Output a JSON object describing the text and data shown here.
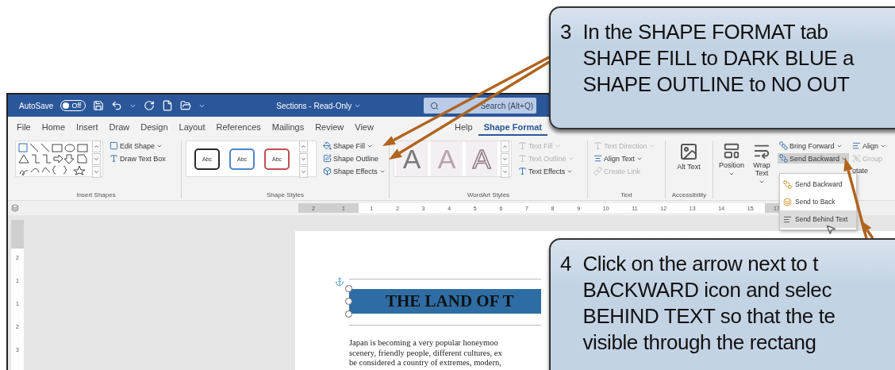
{
  "title_bar": {
    "autosave_label": "AutoSave",
    "autosave_state": "Off",
    "autosave_on": false,
    "document_title": "Sections - Read-Only",
    "search_placeholder": "Search (Alt+Q)"
  },
  "tabs": [
    {
      "label": "File",
      "selected": false
    },
    {
      "label": "Home",
      "selected": false
    },
    {
      "label": "Insert",
      "selected": false
    },
    {
      "label": "Draw",
      "selected": false
    },
    {
      "label": "Design",
      "selected": false
    },
    {
      "label": "Layout",
      "selected": false
    },
    {
      "label": "References",
      "selected": false
    },
    {
      "label": "Mailings",
      "selected": false
    },
    {
      "label": "Review",
      "selected": false
    },
    {
      "label": "View",
      "selected": false
    },
    {
      "label": "Help",
      "selected": false
    },
    {
      "label": "Shape Format",
      "selected": true
    }
  ],
  "ribbon": [
    {
      "kind": "insert_shapes",
      "label": "Insert Shapes",
      "commands": [
        {
          "label": "Edit Shape",
          "dropdown": true,
          "disabled": false
        },
        {
          "label": "Draw Text Box",
          "dropdown": false,
          "disabled": false
        }
      ]
    },
    {
      "kind": "shape_styles",
      "label": "Shape Styles",
      "presets": [
        {
          "label": "Abc",
          "color": "#2b2b2b"
        },
        {
          "label": "Abc",
          "color": "#4f86c6"
        },
        {
          "label": "Abc",
          "color": "#c0504d"
        }
      ],
      "commands": [
        {
          "label": "Shape Fill",
          "dropdown": true,
          "disabled": false
        },
        {
          "label": "Shape Outline",
          "dropdown": false,
          "disabled": false
        },
        {
          "label": "Shape Effects",
          "dropdown": true,
          "disabled": false
        }
      ]
    },
    {
      "kind": "wordart",
      "label": "WordArt Styles",
      "letters": [
        "A",
        "A",
        "A"
      ],
      "commands": [
        {
          "label": "Text Fill",
          "dropdown": true,
          "disabled": true
        },
        {
          "label": "Text Outline",
          "dropdown": true,
          "disabled": true
        },
        {
          "label": "Text Effects",
          "dropdown": true,
          "disabled": false
        }
      ]
    },
    {
      "kind": "text",
      "label": "Text",
      "commands": [
        {
          "label": "Text Direction",
          "dropdown": true,
          "disabled": true
        },
        {
          "label": "Align Text",
          "dropdown": true,
          "disabled": false
        },
        {
          "label": "Create Link",
          "dropdown": false,
          "disabled": true
        }
      ]
    },
    {
      "kind": "accessibility",
      "label": "Accessibility",
      "commands": [
        {
          "label": "Alt Text"
        }
      ]
    },
    {
      "kind": "arrange",
      "large": [
        {
          "label": "Position",
          "dropdown": true
        },
        {
          "label": "Wrap Text",
          "dropdown": true
        }
      ],
      "commands": [
        {
          "label": "Bring Forward",
          "dropdown": true,
          "disabled": false,
          "active": false
        },
        {
          "label": "Send Backward",
          "dropdown": true,
          "disabled": false,
          "active": true
        }
      ],
      "commands_2": [
        {
          "label": "Align",
          "dropdown": true,
          "disabled": false
        },
        {
          "label": "Group",
          "dropdown": false,
          "disabled": true
        },
        {
          "label": "otate",
          "dropdown": false,
          "disabled": false
        }
      ]
    }
  ],
  "ruler": {
    "left_ticks": [
      "2",
      "1"
    ],
    "ticks": [
      "1",
      "2",
      "3",
      "4",
      "5",
      "6",
      "7",
      "8",
      "9",
      "10",
      "11",
      "12",
      "13",
      "14",
      "15"
    ],
    "right_ticks": [
      "17"
    ]
  },
  "vertical_ruler": [
    "2",
    "1",
    "1",
    "2",
    "3"
  ],
  "send_backward_menu": [
    {
      "label": "Send Backward",
      "selected": false
    },
    {
      "label": "Send to Back",
      "selected": false
    },
    {
      "label": "Send Behind Text",
      "selected": true
    }
  ],
  "document": {
    "heading": "THE LAND OF T",
    "paragraph_lines": [
      "Japan is becoming a very popular honeymoo",
      "scenery, friendly people, different cultures, ex",
      "be considered a country of extremes, modern,"
    ]
  },
  "callouts": [
    {
      "number": "3",
      "lines": [
        "In the SHAPE FORMAT tab",
        "SHAPE FILL to DARK BLUE a",
        "SHAPE OUTLINE to NO OUT"
      ]
    },
    {
      "number": "4",
      "lines": [
        "Click on the arrow next to t",
        "BACKWARD icon and selec",
        "BEHIND TEXT so that the te",
        "visible through the rectang"
      ]
    }
  ]
}
